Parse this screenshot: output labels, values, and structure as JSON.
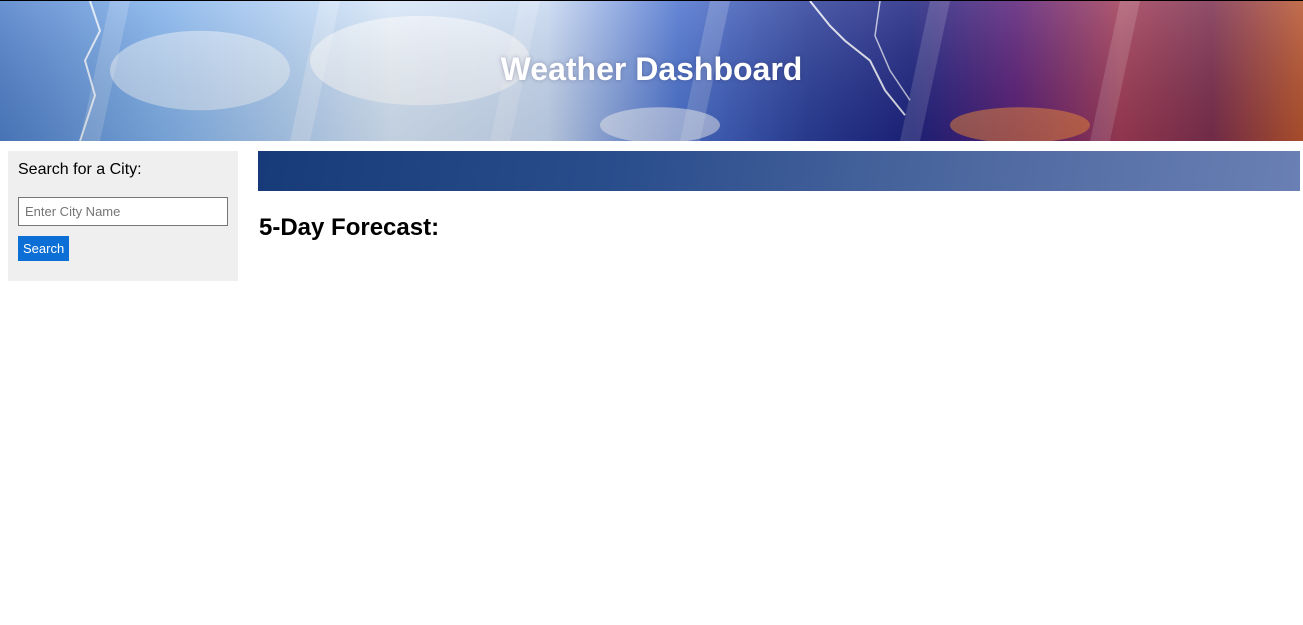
{
  "header": {
    "title": "Weather Dashboard"
  },
  "sidebar": {
    "label": "Search for a City:",
    "input": {
      "placeholder": "Enter City Name",
      "value": ""
    },
    "search_button_label": "Search"
  },
  "main": {
    "current_weather_text": "",
    "forecast_heading": "5-Day Forecast:"
  },
  "colors": {
    "search_button": "#0b6fd6",
    "sidebar_background": "#efefef",
    "current_bar_start": "#173a78",
    "current_bar_end": "#6a80b4"
  }
}
